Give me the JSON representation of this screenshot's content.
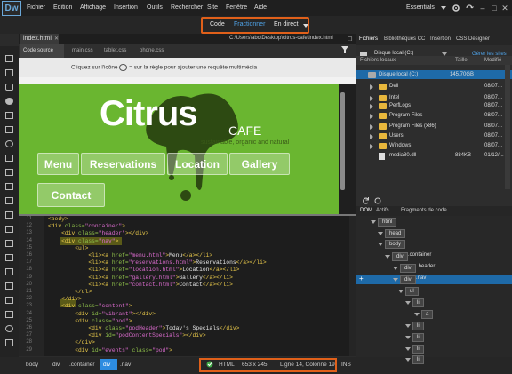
{
  "app": {
    "logo": "Dw"
  },
  "menu": [
    "Fichier",
    "Edition",
    "Affichage",
    "Insertion",
    "Outils",
    "Rechercher",
    "Site",
    "Fenêtre",
    "Aide"
  ],
  "workspace": "Essentials",
  "views": {
    "code": "Code",
    "split": "Fractionner",
    "live": "En direct"
  },
  "doc": {
    "tab": "index.html",
    "path": "C:\\Users\\abc\\Desktop\\citrus-cafe\\index.html",
    "subtabs": [
      "Code source",
      "main.css",
      "tablet.css",
      "phone.css"
    ]
  },
  "mq": {
    "prefix": "Cliquez sur l'icône",
    "suffix": "sur la règle pour ajouter une requête multimédia"
  },
  "page": {
    "logo": "Citrus",
    "cafe": "CAFE",
    "tagline": "sustainable, organic and natural",
    "nav": [
      "Menu",
      "Reservations",
      "Location",
      "Gallery",
      "Contact"
    ]
  },
  "code": {
    "lines": [
      {
        "n": "11",
        "parts": [
          [
            "tg",
            "<body>"
          ]
        ]
      },
      {
        "n": "12",
        "parts": [
          [
            "tg",
            "<div "
          ],
          [
            "at",
            "class="
          ],
          [
            "sv",
            "\"container\""
          ],
          [
            "tg",
            ">"
          ]
        ]
      },
      {
        "n": "13",
        "parts": [
          [
            "tx",
            "    "
          ],
          [
            "tg",
            "<div "
          ],
          [
            "at",
            "class="
          ],
          [
            "sv",
            "\"header\""
          ],
          [
            "tg",
            "></div>"
          ]
        ]
      },
      {
        "n": "14",
        "parts": [
          [
            "tx",
            "    "
          ],
          [
            "tg",
            "<div "
          ],
          [
            "at",
            "class="
          ],
          [
            "sv",
            "\"nav\""
          ],
          [
            "tg",
            ">"
          ]
        ]
      },
      {
        "n": "15",
        "parts": [
          [
            "tx",
            "        "
          ],
          [
            "tg",
            "<ul>"
          ]
        ]
      },
      {
        "n": "16",
        "parts": [
          [
            "tx",
            "            "
          ],
          [
            "tg",
            "<li><a "
          ],
          [
            "at",
            "href="
          ],
          [
            "sv",
            "\"menu.html\""
          ],
          [
            "tg",
            ">"
          ],
          [
            "tx",
            "Menu"
          ],
          [
            "tg",
            "</a></li>"
          ]
        ]
      },
      {
        "n": "17",
        "parts": [
          [
            "tx",
            "            "
          ],
          [
            "tg",
            "<li><a "
          ],
          [
            "at",
            "href="
          ],
          [
            "sv",
            "\"reservations.html\""
          ],
          [
            "tg",
            ">"
          ],
          [
            "tx",
            "Reservations"
          ],
          [
            "tg",
            "</a></li>"
          ]
        ]
      },
      {
        "n": "18",
        "parts": [
          [
            "tx",
            "            "
          ],
          [
            "tg",
            "<li><a "
          ],
          [
            "at",
            "href="
          ],
          [
            "sv",
            "\"location.html\""
          ],
          [
            "tg",
            ">"
          ],
          [
            "tx",
            "Location"
          ],
          [
            "tg",
            "</a></li>"
          ]
        ]
      },
      {
        "n": "19",
        "parts": [
          [
            "tx",
            "            "
          ],
          [
            "tg",
            "<li><a "
          ],
          [
            "at",
            "href="
          ],
          [
            "sv",
            "\"gallery.html\""
          ],
          [
            "tg",
            ">"
          ],
          [
            "tx",
            "Gallery"
          ],
          [
            "tg",
            "</a></li>"
          ]
        ]
      },
      {
        "n": "20",
        "parts": [
          [
            "tx",
            "            "
          ],
          [
            "tg",
            "<li><a "
          ],
          [
            "at",
            "href="
          ],
          [
            "sv",
            "\"contact.html\""
          ],
          [
            "tg",
            ">"
          ],
          [
            "tx",
            "Contact"
          ],
          [
            "tg",
            "</a></li>"
          ]
        ]
      },
      {
        "n": "21",
        "parts": [
          [
            "tx",
            "        "
          ],
          [
            "tg",
            "</ul>"
          ]
        ]
      },
      {
        "n": "22",
        "parts": [
          [
            "tx",
            "    "
          ],
          [
            "tg",
            "</div>"
          ]
        ]
      },
      {
        "n": "23",
        "parts": [
          [
            "tx",
            "    "
          ],
          [
            "tg",
            "<div "
          ],
          [
            "at",
            "class="
          ],
          [
            "sv",
            "\"content\""
          ],
          [
            "tg",
            ">"
          ]
        ]
      },
      {
        "n": "24",
        "parts": [
          [
            "tx",
            "        "
          ],
          [
            "tg",
            "<div "
          ],
          [
            "at",
            "id="
          ],
          [
            "sv",
            "\"vibrant\""
          ],
          [
            "tg",
            "></div>"
          ]
        ]
      },
      {
        "n": "25",
        "parts": [
          [
            "tx",
            "        "
          ],
          [
            "tg",
            "<div "
          ],
          [
            "at",
            "class="
          ],
          [
            "sv",
            "\"pod\""
          ],
          [
            "tg",
            ">"
          ]
        ]
      },
      {
        "n": "26",
        "parts": [
          [
            "tx",
            "            "
          ],
          [
            "tg",
            "<div "
          ],
          [
            "at",
            "class="
          ],
          [
            "sv",
            "\"podHeader\""
          ],
          [
            "tg",
            ">"
          ],
          [
            "tx",
            "Today's Specials"
          ],
          [
            "tg",
            "</div>"
          ]
        ]
      },
      {
        "n": "27",
        "parts": [
          [
            "tx",
            "            "
          ],
          [
            "tg",
            "<div "
          ],
          [
            "at",
            "id="
          ],
          [
            "sv",
            "\"podContentSpecials\""
          ],
          [
            "tg",
            "></div>"
          ]
        ]
      },
      {
        "n": "28",
        "parts": [
          [
            "tx",
            "        "
          ],
          [
            "tg",
            "</div>"
          ]
        ]
      },
      {
        "n": "29",
        "parts": [
          [
            "tx",
            "        "
          ],
          [
            "tg",
            "<div "
          ],
          [
            "at",
            "id="
          ],
          [
            "sv",
            "\"events\" "
          ],
          [
            "at",
            "class="
          ],
          [
            "sv",
            "\"pod\""
          ],
          [
            "tg",
            ">"
          ]
        ]
      }
    ]
  },
  "status": {
    "crumbs": [
      "body",
      "div",
      ".container",
      "div",
      ".nav"
    ],
    "lang": "HTML",
    "size": "653 x 245",
    "pos": "Ligne 14, Colonne 19",
    "mode": "INS"
  },
  "files": {
    "tabs": [
      "Fichiers",
      "Bibliothèques CC",
      "Insertion",
      "CSS Designer"
    ],
    "site": "Disque local (C:)",
    "manage": "Gérer les sites",
    "col_local": "Fichiers locaux",
    "col_size": "Taille",
    "col_mod": "Modifié",
    "rows": [
      {
        "name": "Disque local (C:)",
        "size": "145,70GB",
        "mod": ""
      },
      {
        "name": "Dell",
        "size": "",
        "mod": "08/07..."
      },
      {
        "name": "Intel",
        "size": "",
        "mod": "08/07..."
      },
      {
        "name": "PerfLogs",
        "size": "",
        "mod": "08/07..."
      },
      {
        "name": "Program Files",
        "size": "",
        "mod": "08/07..."
      },
      {
        "name": "Program Files (x86)",
        "size": "",
        "mod": "08/07..."
      },
      {
        "name": "Users",
        "size": "",
        "mod": "08/07..."
      },
      {
        "name": "Windows",
        "size": "",
        "mod": "08/07..."
      },
      {
        "name": "msdia80.dll",
        "size": "884KB",
        "mod": "01/12/..."
      }
    ]
  },
  "dom": {
    "tabs": [
      "DOM",
      "Actifs",
      "Fragments de code"
    ],
    "nodes": [
      "html",
      "head",
      "body",
      "div",
      ".container",
      "div",
      ".header",
      "div",
      ".nav",
      "ul",
      "li",
      "a",
      "li",
      "li",
      "li",
      "li"
    ]
  }
}
